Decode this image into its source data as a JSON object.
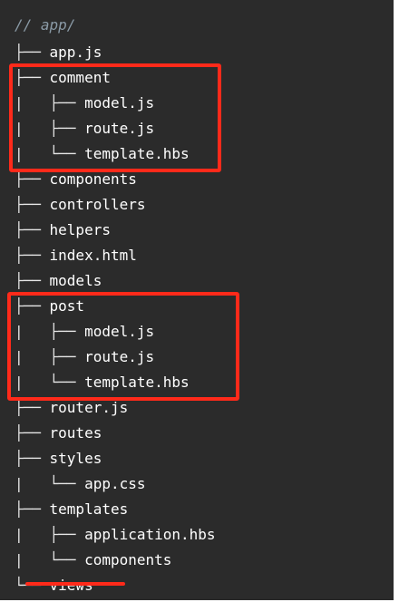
{
  "root_comment": "// app/",
  "tree": [
    {
      "prefix": "├── ",
      "name": "app.js"
    },
    {
      "prefix": "├── ",
      "name": "comment"
    },
    {
      "prefix": "|   ├── ",
      "name": "model.js"
    },
    {
      "prefix": "|   ├── ",
      "name": "route.js"
    },
    {
      "prefix": "|   └── ",
      "name": "template.hbs"
    },
    {
      "prefix": "├── ",
      "name": "components"
    },
    {
      "prefix": "├── ",
      "name": "controllers"
    },
    {
      "prefix": "├── ",
      "name": "helpers"
    },
    {
      "prefix": "├── ",
      "name": "index.html"
    },
    {
      "prefix": "├── ",
      "name": "models"
    },
    {
      "prefix": "├── ",
      "name": "post"
    },
    {
      "prefix": "|   ├── ",
      "name": "model.js"
    },
    {
      "prefix": "|   ├── ",
      "name": "route.js"
    },
    {
      "prefix": "|   └── ",
      "name": "template.hbs"
    },
    {
      "prefix": "├── ",
      "name": "router.js"
    },
    {
      "prefix": "├── ",
      "name": "routes"
    },
    {
      "prefix": "├── ",
      "name": "styles"
    },
    {
      "prefix": "|   └── ",
      "name": "app.css"
    },
    {
      "prefix": "├── ",
      "name": "templates"
    },
    {
      "prefix": "|   ├── ",
      "name": "application.hbs"
    },
    {
      "prefix": "|   └── ",
      "name": "components"
    },
    {
      "prefix": "└── ",
      "name": "views"
    }
  ],
  "colors": {
    "background": "#2b2b2b",
    "highlight": "#ff2a1a"
  }
}
